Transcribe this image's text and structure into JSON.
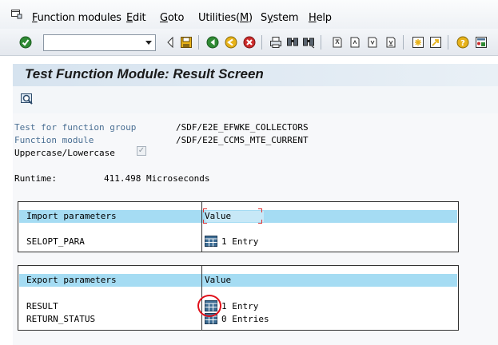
{
  "menubar": {
    "items": [
      {
        "label": "Function modules",
        "ul": "F",
        "rest": "unction modules"
      },
      {
        "label": "Edit",
        "ul": "E",
        "rest": "dit"
      },
      {
        "label": "Goto",
        "ul": "G",
        "rest": "oto"
      },
      {
        "label": "Utilities(M)",
        "pre": "Utilities(",
        "ul": "M",
        "post": ")"
      },
      {
        "label": "System",
        "pre": "S",
        "ul": "y",
        "post": "stem"
      },
      {
        "label": "Help",
        "ul": "H",
        "rest": "elp"
      }
    ]
  },
  "toolbar": {
    "command_value": "",
    "icons": [
      "enter-icon",
      "back-icon",
      "exit-icon",
      "cancel-icon",
      "print-icon",
      "find-icon",
      "find-next-icon",
      "first-page-icon",
      "previous-page-icon",
      "next-page-icon",
      "last-page-icon",
      "create-session-icon",
      "shortcut-icon",
      "help-icon",
      "customize-layout-icon"
    ],
    "colors": {
      "green": "#2f8a34",
      "yellow": "#e7b21a",
      "red": "#cc2b2b"
    }
  },
  "title": {
    "text": "Test Function Module: Result Screen"
  },
  "app_toolbar": {
    "icons": [
      "display-icon"
    ]
  },
  "info": {
    "function_group_label": "Test for function group",
    "function_group_value": "/SDF/E2E_EFWKE_COLLECTORS",
    "function_module_label": "Function module",
    "function_module_value": "/SDF/E2E_CCMS_MTE_CURRENT",
    "uppercase_label": "Uppercase/Lowercase",
    "uppercase_checked": true,
    "runtime_label": "Runtime:",
    "runtime_value": "411.498 Microseconds"
  },
  "import_table": {
    "header_left": "Import parameters",
    "header_right": "Value",
    "rows": [
      {
        "name": "SELOPT_PARA",
        "value": "1 Entry"
      }
    ]
  },
  "export_table": {
    "header_left": "Export parameters",
    "header_right": "Value",
    "rows": [
      {
        "name": "RESULT",
        "value": "1 Entry"
      },
      {
        "name": "RETURN_STATUS",
        "value": "0 Entries"
      }
    ]
  },
  "colors": {
    "header_bg": "#a5dcf3",
    "label_blue": "#4a6f93",
    "highlight_circle": "#e0101a"
  }
}
